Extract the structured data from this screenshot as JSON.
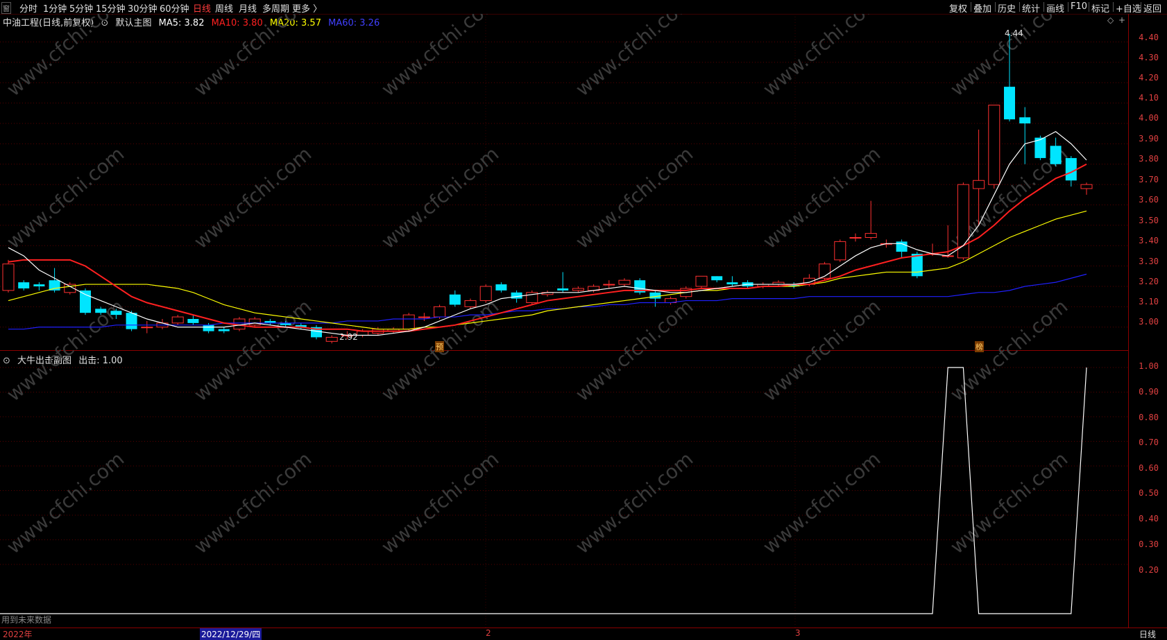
{
  "toolbar": {
    "window_icon": "窗",
    "periods": [
      "分时",
      "1分钟",
      "5分钟",
      "15分钟",
      "30分钟",
      "60分钟",
      "日线",
      "周线",
      "月线",
      "多周期",
      "更多 〉"
    ],
    "active_period": "日线",
    "tools": [
      "复权",
      "叠加",
      "历史",
      "统计",
      "画线",
      "F10",
      "标记",
      "+自选",
      "返回"
    ]
  },
  "main_legend": {
    "stock": "中油工程(日线,前复权)",
    "indicator": "默认主图",
    "ma5": "MA5: 3.82",
    "ma10": "MA10: 3.80",
    "ma20": "MA20: 3.57",
    "ma60": "MA60: 3.26",
    "colors": {
      "ma5": "#ffffff",
      "ma10": "#ff2020",
      "ma20": "#ffff00",
      "ma60": "#2020ff"
    }
  },
  "sub_legend": {
    "indicator": "大牛出击副图",
    "value": "出击: 1.00"
  },
  "price_axis": [
    "4.40",
    "4.30",
    "4.20",
    "4.10",
    "4.00",
    "3.90",
    "3.80",
    "3.70",
    "3.60",
    "3.50",
    "3.40",
    "3.30",
    "3.20",
    "3.10",
    "3.00"
  ],
  "sub_axis": [
    "1.00",
    "0.90",
    "0.80",
    "0.70",
    "0.60",
    "0.50",
    "0.40",
    "0.30",
    "0.20"
  ],
  "annotations": {
    "high": "4.44",
    "low": "2.92",
    "marker_yu": "预",
    "marker_bang": "榜"
  },
  "bottom": {
    "year": "2022年",
    "selected_date": "2022/12/29/四",
    "month_2": "2",
    "month_3": "3",
    "period_label": "日线",
    "future_data": "用到未来数据"
  },
  "watermark": "www.cfchi.com",
  "chart_data": {
    "type": "candlestick",
    "ylim": [
      2.88,
      4.48
    ],
    "candles": [
      {
        "o": 3.18,
        "c": 3.31,
        "h": 3.33,
        "l": 3.17
      },
      {
        "o": 3.22,
        "c": 3.19,
        "h": 3.23,
        "l": 3.18
      },
      {
        "o": 3.21,
        "c": 3.2,
        "h": 3.22,
        "l": 3.18
      },
      {
        "o": 3.23,
        "c": 3.18,
        "h": 3.29,
        "l": 3.17
      },
      {
        "o": 3.17,
        "c": 3.21,
        "h": 3.22,
        "l": 3.16
      },
      {
        "o": 3.18,
        "c": 3.07,
        "h": 3.19,
        "l": 3.06
      },
      {
        "o": 3.09,
        "c": 3.07,
        "h": 3.1,
        "l": 3.06
      },
      {
        "o": 3.08,
        "c": 3.06,
        "h": 3.09,
        "l": 3.04
      },
      {
        "o": 3.07,
        "c": 2.99,
        "h": 3.08,
        "l": 2.98
      },
      {
        "o": 3.0,
        "c": 3.0,
        "h": 3.03,
        "l": 2.97
      },
      {
        "o": 3.0,
        "c": 3.02,
        "h": 3.04,
        "l": 2.99
      },
      {
        "o": 3.02,
        "c": 3.05,
        "h": 3.06,
        "l": 3.01
      },
      {
        "o": 3.04,
        "c": 3.02,
        "h": 3.06,
        "l": 3.01
      },
      {
        "o": 3.01,
        "c": 2.98,
        "h": 3.02,
        "l": 2.97
      },
      {
        "o": 2.99,
        "c": 2.98,
        "h": 3.0,
        "l": 2.97
      },
      {
        "o": 2.99,
        "c": 3.04,
        "h": 3.05,
        "l": 2.98
      },
      {
        "o": 3.01,
        "c": 3.04,
        "h": 3.05,
        "l": 3.0
      },
      {
        "o": 3.03,
        "c": 3.02,
        "h": 3.04,
        "l": 3.01
      },
      {
        "o": 3.02,
        "c": 3.01,
        "h": 3.03,
        "l": 3.0
      },
      {
        "o": 3.01,
        "c": 3.0,
        "h": 3.02,
        "l": 2.99
      },
      {
        "o": 3.0,
        "c": 2.95,
        "h": 3.01,
        "l": 2.94
      },
      {
        "o": 2.93,
        "c": 2.95,
        "h": 2.96,
        "l": 2.92
      },
      {
        "o": 2.96,
        "c": 2.96,
        "h": 2.98,
        "l": 2.94
      },
      {
        "o": 2.96,
        "c": 2.98,
        "h": 2.99,
        "l": 2.95
      },
      {
        "o": 2.97,
        "c": 2.99,
        "h": 3.0,
        "l": 2.96
      },
      {
        "o": 2.98,
        "c": 2.99,
        "h": 3.0,
        "l": 2.97
      },
      {
        "o": 2.99,
        "c": 3.06,
        "h": 3.07,
        "l": 2.98
      },
      {
        "o": 3.05,
        "c": 3.05,
        "h": 3.07,
        "l": 3.03
      },
      {
        "o": 3.05,
        "c": 3.1,
        "h": 3.11,
        "l": 3.04
      },
      {
        "o": 3.16,
        "c": 3.11,
        "h": 3.18,
        "l": 3.1
      },
      {
        "o": 3.1,
        "c": 3.13,
        "h": 3.14,
        "l": 3.09
      },
      {
        "o": 3.13,
        "c": 3.2,
        "h": 3.21,
        "l": 3.12
      },
      {
        "o": 3.21,
        "c": 3.18,
        "h": 3.22,
        "l": 3.17
      },
      {
        "o": 3.17,
        "c": 3.14,
        "h": 3.18,
        "l": 3.12
      },
      {
        "o": 3.12,
        "c": 3.17,
        "h": 3.18,
        "l": 3.11
      },
      {
        "o": 3.16,
        "c": 3.17,
        "h": 3.18,
        "l": 3.15
      },
      {
        "o": 3.19,
        "c": 3.18,
        "h": 3.27,
        "l": 3.17
      },
      {
        "o": 3.18,
        "c": 3.19,
        "h": 3.2,
        "l": 3.17
      },
      {
        "o": 3.18,
        "c": 3.2,
        "h": 3.21,
        "l": 3.17
      },
      {
        "o": 3.21,
        "c": 3.21,
        "h": 3.23,
        "l": 3.19
      },
      {
        "o": 3.21,
        "c": 3.23,
        "h": 3.24,
        "l": 3.2
      },
      {
        "o": 3.23,
        "c": 3.17,
        "h": 3.24,
        "l": 3.16
      },
      {
        "o": 3.17,
        "c": 3.14,
        "h": 3.18,
        "l": 3.1
      },
      {
        "o": 3.12,
        "c": 3.14,
        "h": 3.15,
        "l": 3.11
      },
      {
        "o": 3.15,
        "c": 3.19,
        "h": 3.2,
        "l": 3.14
      },
      {
        "o": 3.2,
        "c": 3.25,
        "h": 3.25,
        "l": 3.19
      },
      {
        "o": 3.25,
        "c": 3.23,
        "h": 3.25,
        "l": 3.22
      },
      {
        "o": 3.22,
        "c": 3.21,
        "h": 3.25,
        "l": 3.2
      },
      {
        "o": 3.22,
        "c": 3.2,
        "h": 3.23,
        "l": 3.19
      },
      {
        "o": 3.2,
        "c": 3.21,
        "h": 3.22,
        "l": 3.19
      },
      {
        "o": 3.21,
        "c": 3.22,
        "h": 3.23,
        "l": 3.2
      },
      {
        "o": 3.21,
        "c": 3.2,
        "h": 3.22,
        "l": 3.19
      },
      {
        "o": 3.21,
        "c": 3.24,
        "h": 3.26,
        "l": 3.2
      },
      {
        "o": 3.24,
        "c": 3.31,
        "h": 3.32,
        "l": 3.23
      },
      {
        "o": 3.33,
        "c": 3.42,
        "h": 3.43,
        "l": 3.32
      },
      {
        "o": 3.44,
        "c": 3.44,
        "h": 3.46,
        "l": 3.42
      },
      {
        "o": 3.44,
        "c": 3.46,
        "h": 3.62,
        "l": 3.43
      },
      {
        "o": 3.41,
        "c": 3.41,
        "h": 3.43,
        "l": 3.39
      },
      {
        "o": 3.42,
        "c": 3.37,
        "h": 3.43,
        "l": 3.34
      },
      {
        "o": 3.36,
        "c": 3.25,
        "h": 3.37,
        "l": 3.24
      },
      {
        "o": 3.36,
        "c": 3.36,
        "h": 3.41,
        "l": 3.35
      },
      {
        "o": 3.35,
        "c": 3.35,
        "h": 3.5,
        "l": 3.34
      },
      {
        "o": 3.34,
        "c": 3.7,
        "h": 3.71,
        "l": 3.33
      },
      {
        "o": 3.68,
        "c": 3.72,
        "h": 3.97,
        "l": 3.5
      },
      {
        "o": 3.7,
        "c": 4.09,
        "h": 4.09,
        "l": 3.68
      },
      {
        "o": 4.18,
        "c": 4.02,
        "h": 4.44,
        "l": 4.01
      },
      {
        "o": 4.03,
        "c": 4.0,
        "h": 4.08,
        "l": 3.8
      },
      {
        "o": 3.93,
        "c": 3.83,
        "h": 3.94,
        "l": 3.82
      },
      {
        "o": 3.89,
        "c": 3.8,
        "h": 3.93,
        "l": 3.79
      },
      {
        "o": 3.83,
        "c": 3.72,
        "h": 3.84,
        "l": 3.69
      },
      {
        "o": 3.68,
        "c": 3.7,
        "h": 3.71,
        "l": 3.65
      }
    ],
    "ma5": [
      3.39,
      3.35,
      3.28,
      3.24,
      3.2,
      3.16,
      3.13,
      3.1,
      3.07,
      3.04,
      3.02,
      3.0,
      3.0,
      3.0,
      3.0,
      3.01,
      3.02,
      3.01,
      3.0,
      2.99,
      2.98,
      2.97,
      2.96,
      2.96,
      2.96,
      2.97,
      2.98,
      3.0,
      3.03,
      3.06,
      3.09,
      3.11,
      3.14,
      3.15,
      3.16,
      3.17,
      3.17,
      3.17,
      3.18,
      3.19,
      3.2,
      3.19,
      3.18,
      3.17,
      3.17,
      3.18,
      3.19,
      3.2,
      3.21,
      3.21,
      3.21,
      3.21,
      3.22,
      3.25,
      3.3,
      3.35,
      3.39,
      3.41,
      3.41,
      3.38,
      3.36,
      3.35,
      3.4,
      3.5,
      3.65,
      3.8,
      3.9,
      3.92,
      3.96,
      3.9,
      3.82
    ],
    "ma10": [
      3.32,
      3.33,
      3.33,
      3.33,
      3.33,
      3.3,
      3.25,
      3.2,
      3.15,
      3.12,
      3.1,
      3.08,
      3.06,
      3.04,
      3.02,
      3.01,
      3.0,
      3.0,
      3.0,
      3.0,
      2.99,
      2.99,
      2.99,
      2.98,
      2.98,
      2.98,
      2.98,
      2.99,
      3.0,
      3.01,
      3.03,
      3.05,
      3.07,
      3.09,
      3.11,
      3.13,
      3.14,
      3.15,
      3.16,
      3.17,
      3.18,
      3.18,
      3.18,
      3.18,
      3.18,
      3.19,
      3.19,
      3.19,
      3.19,
      3.2,
      3.2,
      3.21,
      3.21,
      3.23,
      3.25,
      3.28,
      3.3,
      3.32,
      3.34,
      3.35,
      3.36,
      3.37,
      3.4,
      3.44,
      3.5,
      3.57,
      3.63,
      3.68,
      3.73,
      3.76,
      3.8
    ],
    "ma20": [
      3.13,
      3.15,
      3.17,
      3.19,
      3.2,
      3.21,
      3.21,
      3.21,
      3.21,
      3.21,
      3.2,
      3.19,
      3.17,
      3.14,
      3.11,
      3.09,
      3.07,
      3.06,
      3.05,
      3.04,
      3.03,
      3.02,
      3.01,
      3.0,
      2.99,
      2.99,
      2.99,
      3.0,
      3.0,
      3.01,
      3.02,
      3.03,
      3.04,
      3.05,
      3.06,
      3.08,
      3.09,
      3.1,
      3.11,
      3.12,
      3.13,
      3.14,
      3.15,
      3.16,
      3.17,
      3.18,
      3.18,
      3.19,
      3.19,
      3.2,
      3.2,
      3.2,
      3.21,
      3.22,
      3.24,
      3.25,
      3.26,
      3.27,
      3.27,
      3.27,
      3.28,
      3.29,
      3.32,
      3.36,
      3.4,
      3.44,
      3.47,
      3.5,
      3.53,
      3.55,
      3.57
    ],
    "ma60": [
      2.99,
      2.99,
      3.0,
      3.0,
      3.0,
      3.0,
      3.0,
      3.01,
      3.01,
      3.01,
      3.01,
      3.01,
      3.01,
      3.01,
      3.02,
      3.02,
      3.02,
      3.02,
      3.02,
      3.02,
      3.02,
      3.02,
      3.03,
      3.03,
      3.03,
      3.04,
      3.04,
      3.04,
      3.05,
      3.05,
      3.06,
      3.06,
      3.07,
      3.08,
      3.08,
      3.09,
      3.09,
      3.1,
      3.1,
      3.11,
      3.11,
      3.12,
      3.12,
      3.12,
      3.13,
      3.13,
      3.13,
      3.14,
      3.14,
      3.14,
      3.14,
      3.14,
      3.15,
      3.15,
      3.15,
      3.15,
      3.15,
      3.15,
      3.15,
      3.15,
      3.15,
      3.15,
      3.16,
      3.17,
      3.17,
      3.18,
      3.2,
      3.21,
      3.22,
      3.24,
      3.26
    ],
    "sub_series": [
      0,
      0,
      0,
      0,
      0,
      0,
      0,
      0,
      0,
      0,
      0,
      0,
      0,
      0,
      0,
      0,
      0,
      0,
      0,
      0,
      0,
      0,
      0,
      0,
      0,
      0,
      0,
      0,
      0,
      0,
      0,
      0,
      0,
      0,
      0,
      0,
      0,
      0,
      0,
      0,
      0,
      0,
      0,
      0,
      0,
      0,
      0,
      0,
      0,
      0,
      0,
      0,
      0,
      0,
      0,
      0,
      0,
      0,
      0,
      0,
      0,
      1,
      1,
      0,
      0,
      0,
      0,
      0,
      0,
      0,
      1
    ],
    "sub_ylim": [
      0,
      1.0
    ]
  }
}
